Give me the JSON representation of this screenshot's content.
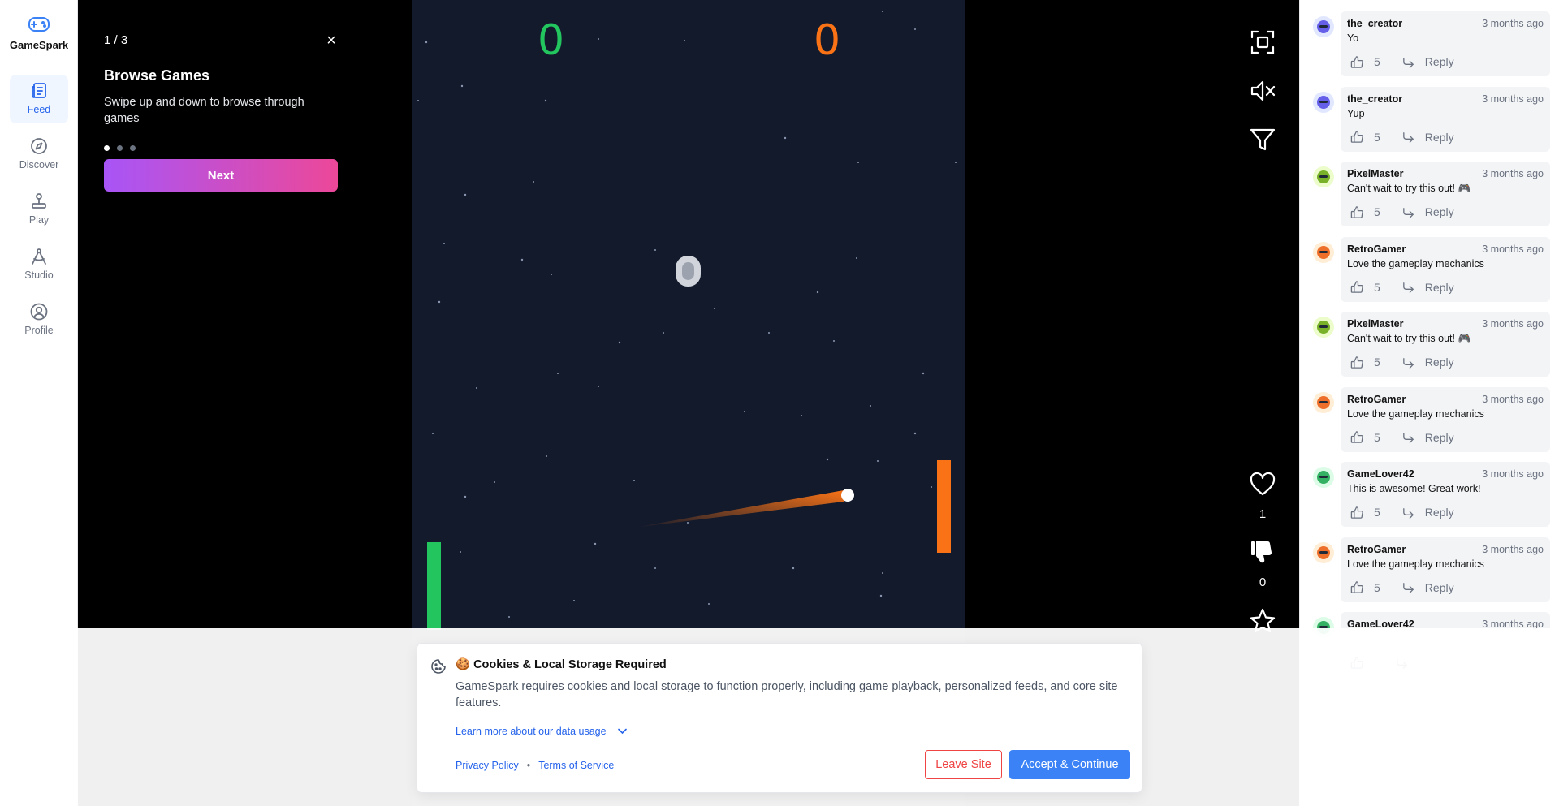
{
  "brand": {
    "name": "GameSpark",
    "icon": "gamepad-icon"
  },
  "nav": [
    {
      "label": "Feed",
      "icon": "feed-icon",
      "active": true
    },
    {
      "label": "Discover",
      "icon": "compass-icon"
    },
    {
      "label": "Play",
      "icon": "joystick-icon"
    },
    {
      "label": "Studio",
      "icon": "compass-drafting-icon"
    },
    {
      "label": "Profile",
      "icon": "user-circle-icon"
    }
  ],
  "tutorial": {
    "step": "1 / 3",
    "close": "×",
    "title": "Browse Games",
    "description": "Swipe up and down to browse through games",
    "next_label": "Next"
  },
  "game": {
    "score_left": "0",
    "score_right": "0",
    "colors": {
      "left": "#22c55e",
      "right": "#f97316",
      "background": "#131a2c"
    }
  },
  "actions": {
    "likes": "1",
    "dislikes": "0"
  },
  "comments": [
    {
      "user": "the_creator",
      "time": "3 months ago",
      "text": "Yo",
      "likes": "5",
      "reply": "Reply",
      "avatar": "creator-avatar"
    },
    {
      "user": "the_creator",
      "time": "3 months ago",
      "text": "Yup",
      "likes": "5",
      "reply": "Reply",
      "avatar": "creator-avatar"
    },
    {
      "user": "PixelMaster",
      "time": "3 months ago",
      "text": "Can't wait to try this out! 🎮",
      "likes": "5",
      "reply": "Reply",
      "avatar": "pixel-avatar"
    },
    {
      "user": "RetroGamer",
      "time": "3 months ago",
      "text": "Love the gameplay mechanics",
      "likes": "5",
      "reply": "Reply",
      "avatar": "retro-avatar"
    },
    {
      "user": "PixelMaster",
      "time": "3 months ago",
      "text": "Can't wait to try this out! 🎮",
      "likes": "5",
      "reply": "Reply",
      "avatar": "pixel-avatar"
    },
    {
      "user": "RetroGamer",
      "time": "3 months ago",
      "text": "Love the gameplay mechanics",
      "likes": "5",
      "reply": "Reply",
      "avatar": "retro-avatar"
    },
    {
      "user": "GameLover42",
      "time": "3 months ago",
      "text": "This is awesome! Great work!",
      "likes": "5",
      "reply": "Reply",
      "avatar": "lover-avatar"
    },
    {
      "user": "RetroGamer",
      "time": "3 months ago",
      "text": "Love the gameplay mechanics",
      "likes": "5",
      "reply": "Reply",
      "avatar": "retro-avatar"
    },
    {
      "user": "GameLover42",
      "time": "3 months ago",
      "text": "",
      "likes": "",
      "reply": "",
      "avatar": "lover-avatar"
    }
  ],
  "cookie": {
    "title": "🍪 Cookies & Local Storage Required",
    "description": "GameSpark requires cookies and local storage to function properly, including game playback, personalized feeds, and core site features.",
    "learn_more": "Learn more about our data usage",
    "privacy": "Privacy Policy",
    "separator": "•",
    "terms": "Terms of Service",
    "leave": "Leave Site",
    "accept": "Accept & Continue"
  }
}
